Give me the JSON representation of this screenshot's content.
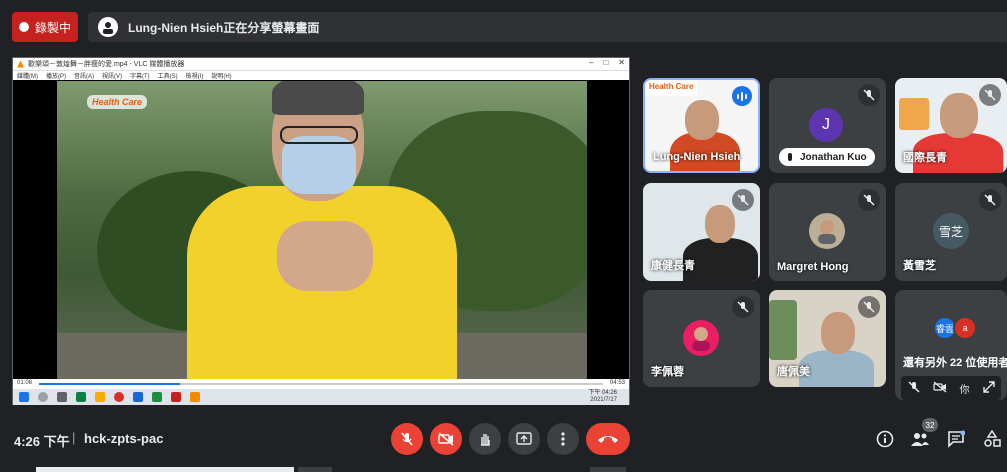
{
  "recording": {
    "label": "錄製中"
  },
  "presenting": {
    "text": "Lung-Nien Hsieh正在分享螢幕畫面"
  },
  "vlc": {
    "title": "歡樂頌－敦煌舞－胖瘦的愛.mp4 - VLC 媒體播放器",
    "menu": [
      "媒體(M)",
      "播放(P)",
      "音訊(A)",
      "視訊(V)",
      "字幕(T)",
      "工具(S)",
      "檢視(I)",
      "說明(H)"
    ],
    "time_elapsed": "01:08",
    "time_total": "04:53",
    "progress": 0.25
  },
  "video": {
    "logo": "Health Care"
  },
  "taskbar": {
    "time": "下午 04:26",
    "date": "2021/7/17"
  },
  "participants": [
    {
      "name": "Lung-Nien Hsieh",
      "banner": "Health Care",
      "speaking": true
    },
    {
      "name": "Jonathan Kuo",
      "initial": "J",
      "color": "#5e35b1"
    },
    {
      "name": "國際長青"
    },
    {
      "name": "康健長青"
    },
    {
      "name": "Margret Hong"
    },
    {
      "name": "黃雪芝",
      "initial": "雪芝",
      "color": "#455a64"
    },
    {
      "name": "李佩蓉"
    },
    {
      "name": "唐佩美"
    }
  ],
  "more": {
    "avatars": [
      {
        "label": "睿雲",
        "color": "#1a73e8"
      },
      {
        "label": "a",
        "color": "#d93025"
      }
    ],
    "text": "還有另外 22 位使用者",
    "you_label": "你"
  },
  "meeting": {
    "time": "4:26 下午",
    "separator": "|",
    "code": "hck-zpts-pac"
  },
  "people_count": "32",
  "colors": {
    "accent": "#8ab4f8",
    "danger": "#ea4335",
    "background": "#202124",
    "tile": "#3c4043"
  }
}
